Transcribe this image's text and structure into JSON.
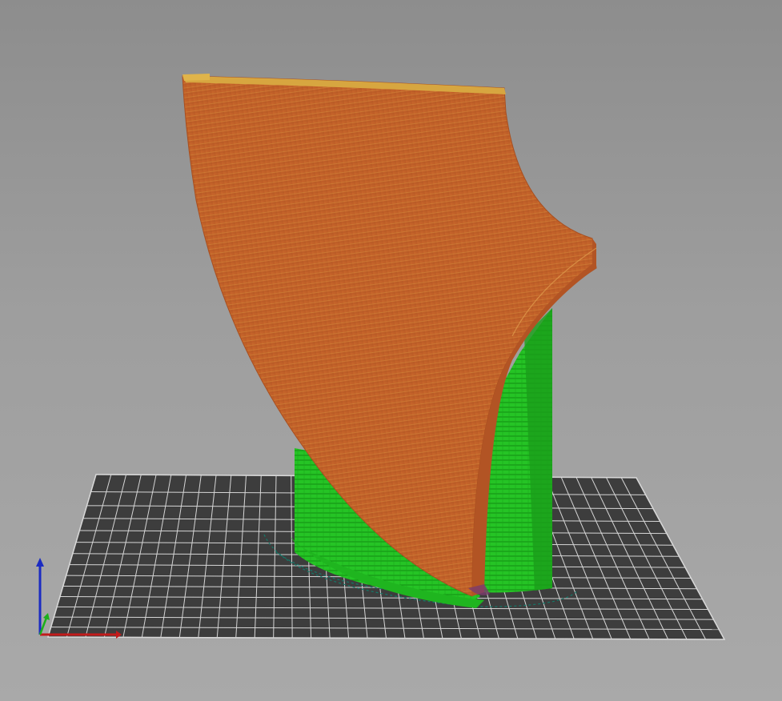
{
  "scene": {
    "view": "3d-preview",
    "colors": {
      "background_top": "#8d8d8d",
      "background_bottom": "#a9a9a9",
      "bed_fill": "#3f3f3f",
      "bed_grid": "#d8d8d8",
      "model_perimeter": "#c2622a",
      "model_highlight": "#d98a3c",
      "support": "#22c022",
      "support_dark": "#139013",
      "axis_x": "#c21b1b",
      "axis_z": "#1b2bc2",
      "axis_y": "#1bb01b"
    },
    "icons": {
      "axis_gizmo": "axis-gizmo-icon"
    }
  }
}
